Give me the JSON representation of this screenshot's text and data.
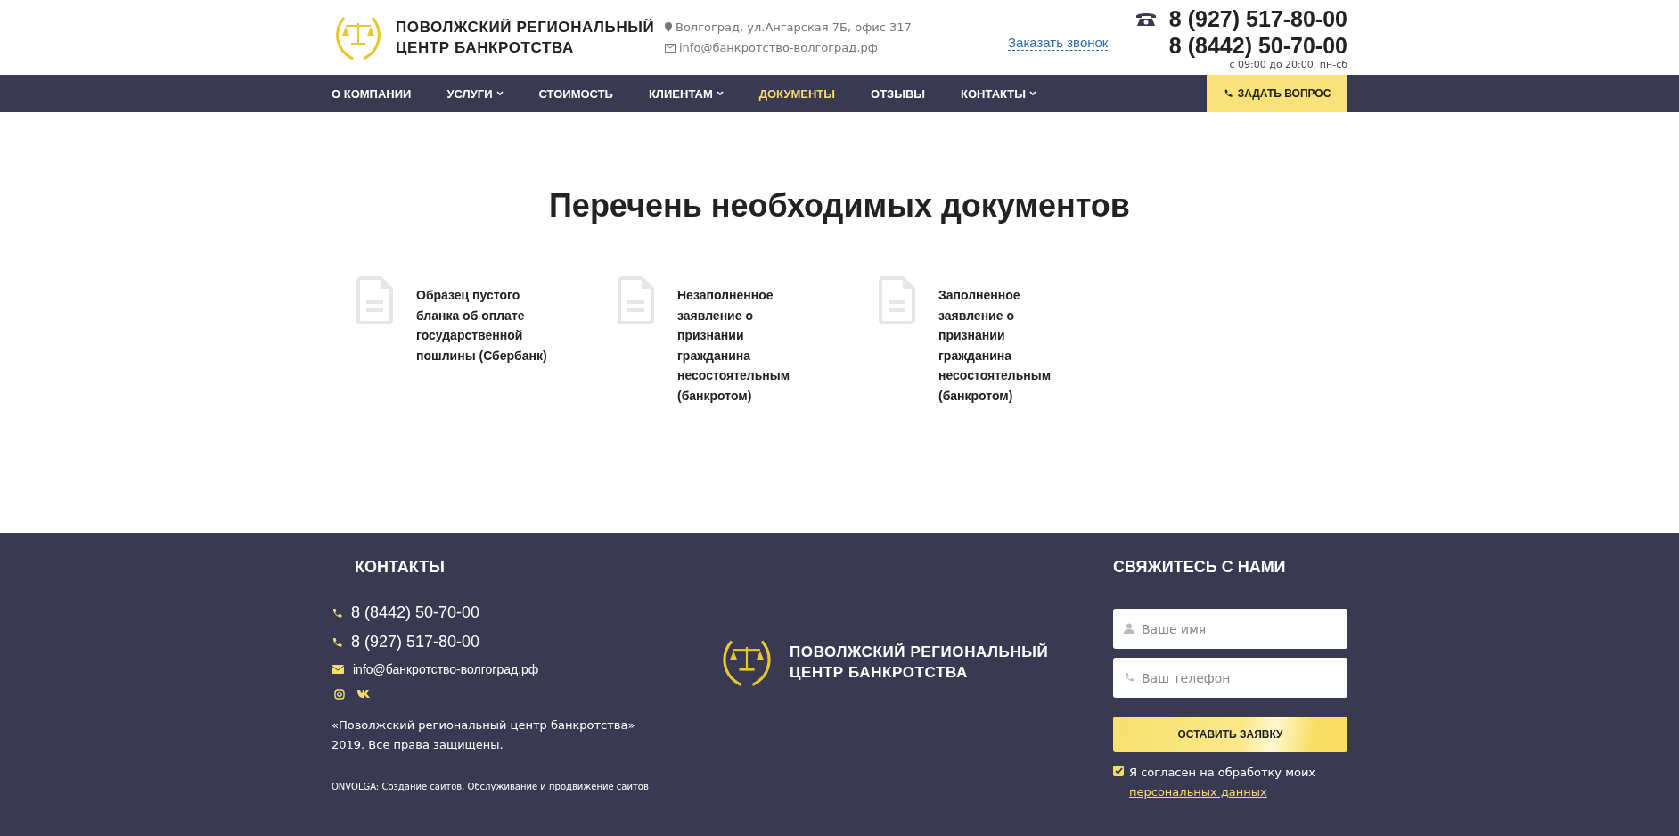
{
  "header": {
    "brand": [
      "ПОВОЛЖСКИЙ РЕГИОНАЛЬНЫЙ",
      "ЦЕНТР БАНКРОТСТВА"
    ],
    "address": "Волгоград, ул.Ангарская 7Б, офис 317",
    "email": "info@банкротство-волгоград.рф",
    "callback_link": "Заказать звонок",
    "phones": [
      "8 (927) 517-80-00",
      "8 (8442) 50-70-00"
    ],
    "hours": "с 09:00 до 20:00, пн-сб"
  },
  "nav": {
    "items": [
      {
        "label": "О КОМПАНИИ",
        "dropdown": false,
        "selected": false
      },
      {
        "label": "УСЛУГИ",
        "dropdown": true,
        "selected": false
      },
      {
        "label": "СТОИМОСТЬ",
        "dropdown": false,
        "selected": false
      },
      {
        "label": "КЛИЕНТАМ",
        "dropdown": true,
        "selected": false
      },
      {
        "label": "ДОКУМЕНТЫ",
        "dropdown": false,
        "selected": true
      },
      {
        "label": "ОТЗЫВЫ",
        "dropdown": false,
        "selected": false
      },
      {
        "label": "КОНТАКТЫ",
        "dropdown": true,
        "selected": false
      }
    ],
    "ask_button": "ЗАДАТЬ ВОПРОС"
  },
  "page_title": "Перечень необходимых документов",
  "documents": [
    "Образец пустого бланка об оплате государственной пошлины (Сбербанк)",
    "Незаполненное заявление о признании гражданина несостоятельным (банкротом)",
    "Заполненное заявление о признании гражданина несостоятельным (банкротом)"
  ],
  "footer": {
    "contacts_title": "КОНТАКТЫ",
    "phones": [
      "8 (8442) 50-70-00",
      "8 (927) 517-80-00"
    ],
    "email": "info@банкротство-волгоград.рф",
    "copyright": [
      "«Поволжский региональный центр банкротства»",
      "2019. Все права защищены."
    ],
    "credit_link": "ONVOLGA: Создание сайтов. Обслуживание и продвижение сайтов",
    "brand": [
      "ПОВОЛЖСКИЙ РЕГИОНАЛЬНЫЙ",
      "ЦЕНТР БАНКРОТСТВА"
    ],
    "form": {
      "title": "СВЯЖИТЕСЬ С НАМИ",
      "name_placeholder": "Ваше имя",
      "phone_placeholder": "Ваш телефон",
      "submit": "ОСТАВИТЬ ЗАЯВКУ",
      "consent_checked": true,
      "consent_text": "Я согласен на обработку моих",
      "consent_link": "персональных данных"
    }
  }
}
